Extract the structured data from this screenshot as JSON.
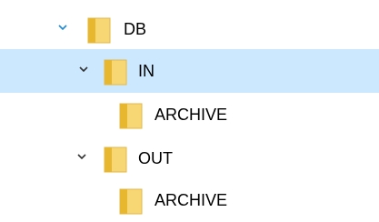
{
  "colors": {
    "selection_background": "#cce8ff",
    "chevron_active": "#1e8ad3",
    "chevron_default": "#333333",
    "folder_body": "#f7d774",
    "folder_tab": "#e8b730"
  },
  "tree": {
    "items": [
      {
        "label": "DB",
        "expanded": true,
        "selected": false,
        "chevron_icon": "chevron-down-icon",
        "icon": "folder-icon"
      },
      {
        "label": "IN",
        "expanded": true,
        "selected": true,
        "chevron_icon": "chevron-down-icon",
        "icon": "folder-icon"
      },
      {
        "label": "ARCHIVE",
        "expanded": false,
        "selected": false,
        "icon": "folder-icon"
      },
      {
        "label": "OUT",
        "expanded": true,
        "selected": false,
        "chevron_icon": "chevron-down-icon",
        "icon": "folder-icon"
      },
      {
        "label": "ARCHIVE",
        "expanded": false,
        "selected": false,
        "icon": "folder-icon"
      }
    ]
  }
}
